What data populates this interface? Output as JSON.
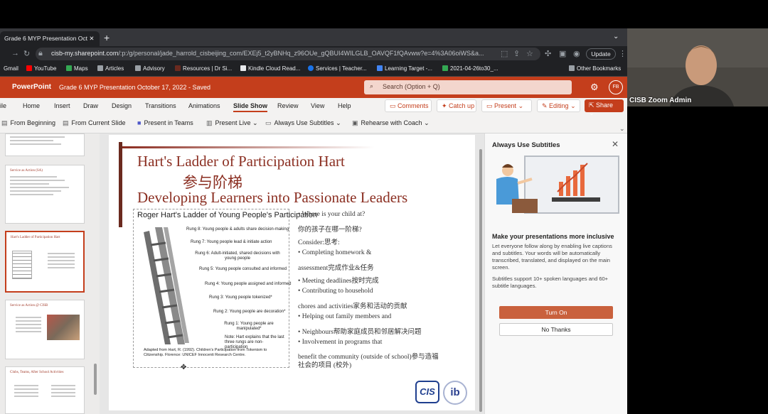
{
  "browser": {
    "tab_title": "Grade 6 MYP Presentation Oct",
    "url_domain": "cisb-my.sharepoint.com",
    "url_rest": "/:p:/g/personal/jade_harrold_cisbeijing_com/EXEj5_t2yBNHq_z96OUe_gQBUI4WILGLB_OAVQF1fQAvww?e=4%3A06oiWS&a...",
    "update_label": "Update",
    "bookmarks": [
      {
        "label": "Gmail",
        "color": "#ea4335"
      },
      {
        "label": "YouTube",
        "color": "#ff0000"
      },
      {
        "label": "Maps",
        "color": "#34a853"
      },
      {
        "label": "Articles",
        "color": "#9aa0a6"
      },
      {
        "label": "Advisory",
        "color": "#9aa0a6"
      },
      {
        "label": "Resources | Dr Si...",
        "color": "#6b2a1f"
      },
      {
        "label": "Kindle Cloud Read...",
        "color": "#e8eaed"
      },
      {
        "label": "Services | Teacher...",
        "color": "#1a73e8"
      },
      {
        "label": "Learning Target -...",
        "color": "#4285f4"
      },
      {
        "label": "2021-04-26to30_...",
        "color": "#34a853"
      }
    ],
    "other_bookmarks": "Other Bookmarks"
  },
  "ppt": {
    "app_name": "PowerPoint",
    "doc_title": "Grade 6 MYP Presentation October 17, 2022  -  Saved",
    "search_placeholder": "Search (Option + Q)",
    "avatar": "FB",
    "tabs": [
      "ile",
      "Home",
      "Insert",
      "Draw",
      "Design",
      "Transitions",
      "Animations",
      "Slide Show",
      "Review",
      "View",
      "Help"
    ],
    "buttons": {
      "comments": "Comments",
      "catchup": "Catch up",
      "present": "Present",
      "editing": "Editing",
      "share": "Share"
    },
    "commands": [
      "From Beginning",
      "From Current Slide",
      "Present in Teams",
      "Present Live",
      "Always Use Subtitles",
      "Rehearse with Coach"
    ]
  },
  "thumbnails": {
    "t2_title": "Service as Action (SA)",
    "t3_title": "Hart's Ladder of Participation Hart",
    "t4_title": "Service as Action @ CISB",
    "t5_title": "Clubs, Teams, After School Activities"
  },
  "slide": {
    "title1": "Hart's Ladder of Participation Hart",
    "title2": "参与阶梯",
    "title3": "Developing Learners into Passionate Leaders",
    "figure_title": "Roger Hart's Ladder of Young People's Participation",
    "rungs": [
      "Rung 8: Young people & adults share decision-making",
      "Rung 7: Young people lead & initiate action",
      "Rung 6: Adult-initiated, shared decisions with young people",
      "Rung 5: Young people consulted and informed",
      "Rung 4: Young people assigned and informed",
      "Rung 3: Young people tokenized*",
      "Rung 2: Young people are decoration*",
      "Rung 1: Young people are manipulated*"
    ],
    "note": "Note: Hart explains that the last three rungs are non-participation",
    "caption": "Adapted from Hart, R. (1992). Children's Participation from Tokenism to Citizenship. Florence: UNICEF Innocenti Research Centre.",
    "lines": [
      "•  Where is your child at?",
      "你的孩子在哪一阶梯?",
      "Consider:思考:",
      "•  Completing homework &",
      "assessment完成作业&任务",
      "•  Meeting deadlines按时完成",
      "•  Contributing to household",
      "chores and activities家务和活动的贡献",
      "•  Helping out family members and",
      "•  Neighbours帮助家庭成员和邻居解决问题",
      "•  Involvement in programs that",
      "benefit the community (outside of school)参与造福",
      "社会的项目 (校外)"
    ],
    "logo_left": "CIS",
    "logo_right": "ib"
  },
  "panel": {
    "title": "Always Use Subtitles",
    "heading": "Make your presentations more inclusive",
    "body1": "Let everyone follow along by enabling live captions and subtitles. Your words will be automatically transcribed, translated, and displayed on the main screen.",
    "body2": "Subtitles support 10+ spoken languages and 60+ subtitle languages.",
    "turn_on": "Turn On",
    "no_thanks": "No Thanks"
  },
  "zoom": {
    "name": "CISB Zoom Admin"
  }
}
